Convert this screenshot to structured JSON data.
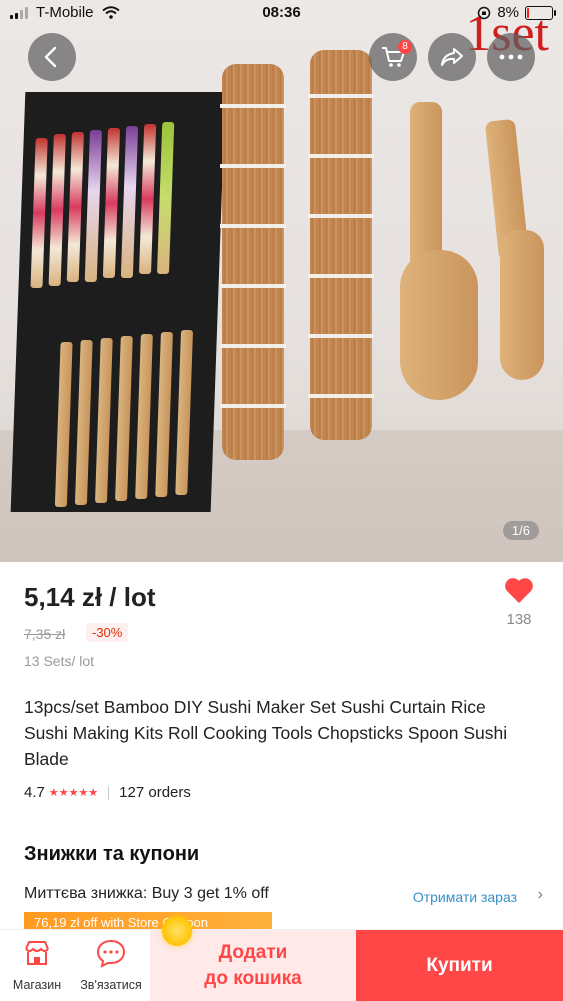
{
  "status_bar": {
    "carrier": "T-Mobile",
    "time": "08:36",
    "battery": "8%",
    "battery_level": 0.08
  },
  "hero": {
    "overlay_text": "1set",
    "image_counter": "1/6",
    "cart_badge": "8"
  },
  "icons": {
    "back": "chevron-left-icon",
    "cart": "cart-icon",
    "share": "share-icon",
    "more": "more-icon",
    "heart": "heart-icon",
    "store": "store-icon",
    "chat": "chat-icon",
    "wifi": "wifi-icon"
  },
  "colors": {
    "accent": "#ff4747",
    "link": "#3a8fc9",
    "coupon": "#ff9a1f"
  },
  "product": {
    "price": "5,14 zł / lot",
    "old_price": "7,35 zł",
    "discount": "-30%",
    "lot_info": "13 Sets/ lot",
    "wishlist_count": "138",
    "title": "13pcs/set  Bamboo DIY Sushi Maker Set Sushi Curtain Rice Sushi Making Kits Roll Cooking Tools Chopsticks Spoon Sushi Blade",
    "rating": "4.7",
    "stars": "★★★★★",
    "orders": "127 orders"
  },
  "discounts": {
    "section_title": "Знижки та купони",
    "instant_discount": "Миттєва знижка: Buy 3 get 1% off",
    "get_now": "Отримати зараз",
    "chevron": "›",
    "coupon_text": "76,19 zł off with Store Coupon"
  },
  "bottom_bar": {
    "store_label": "Магазин",
    "chat_label": "Зв'язатися",
    "add_to_cart_line1": "Додати",
    "add_to_cart_line2": "до кошика",
    "buy_now": "Купити"
  }
}
